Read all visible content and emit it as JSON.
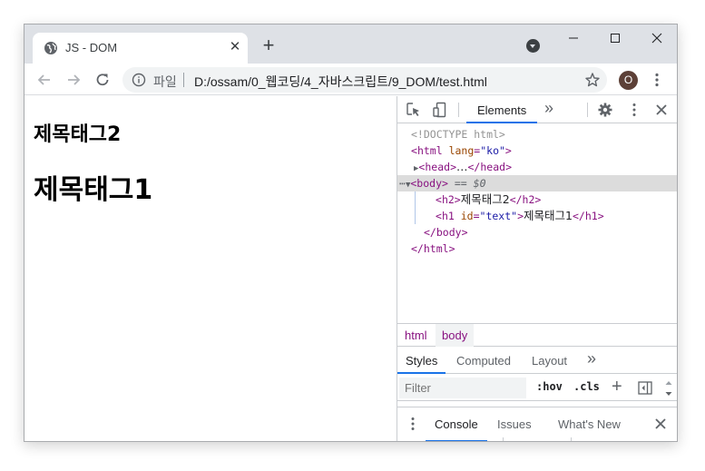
{
  "tab": {
    "title": "JS - DOM",
    "close_glyph": "✕"
  },
  "newtab_glyph": "+",
  "omnibox": {
    "scheme_label": "파일",
    "url": "D:/ossam/0_웹코딩/4_자바스크립트/9_DOM/test.html"
  },
  "profile": {
    "initial": "O",
    "color": "#5d4037"
  },
  "page": {
    "h2_text": "제목태그2",
    "h1_text": "제목태그1"
  },
  "devtools": {
    "main_tabs": {
      "elements": "Elements",
      "more": "»"
    },
    "dom": {
      "doctype": "<!DOCTYPE html>",
      "html_open": "html",
      "lang_attr": "lang",
      "lang_val": "\"ko\"",
      "head_collapsed": "head",
      "head_ellipsis": "…",
      "body_tag": "body",
      "body_marker": "== $0",
      "h2_tag": "h2",
      "h2_text": "제목태그2",
      "h1_tag": "h1",
      "h1_attr": "id",
      "h1_attr_val": "\"text\"",
      "h1_text": "제목태그1"
    },
    "breadcrumbs": [
      "html",
      "body"
    ],
    "style_tabs": [
      "Styles",
      "Computed",
      "Layout"
    ],
    "style_more": "»",
    "filter": {
      "placeholder": "Filter",
      "hov": ":hov",
      "cls": ".cls",
      "plus": "+"
    },
    "drawer_tabs": [
      "Console",
      "Issues",
      "What's New"
    ]
  },
  "colors": {
    "accent": "#1a73e8",
    "tag": "#881280",
    "attr": "#994500",
    "value": "#1a1aa6"
  }
}
